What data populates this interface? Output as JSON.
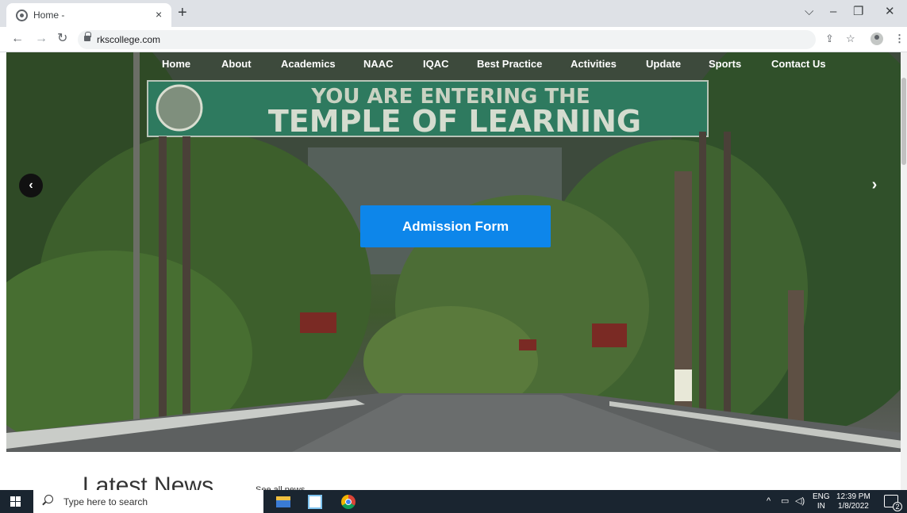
{
  "browser": {
    "tab_title": "Home -",
    "tab_close": "×",
    "new_tab": "+",
    "url": "rkscollege.com",
    "controls": {
      "menu": "⌵",
      "minimize": "–",
      "restore": "❐",
      "close": "✕"
    }
  },
  "site_nav": {
    "items": [
      {
        "label": "Home"
      },
      {
        "label": "About"
      },
      {
        "label": "Academics"
      },
      {
        "label": "NAAC"
      },
      {
        "label": "IQAC"
      },
      {
        "label": "Best Practice"
      },
      {
        "label": "Activities"
      },
      {
        "label": "Update"
      },
      {
        "label": "Sports"
      },
      {
        "label": "Contact Us"
      }
    ]
  },
  "hero": {
    "arch_line1": "YOU ARE ENTERING THE",
    "arch_line2": "TEMPLE OF LEARNING",
    "admission_label": "Admission Form",
    "prev_label": "‹",
    "next_label": "›"
  },
  "news": {
    "heading": "Latest News",
    "see_all": "See all news"
  },
  "taskbar": {
    "search_placeholder": "Type here to search",
    "lang_top": "ENG",
    "lang_bottom": "IN",
    "time": "12:39 PM",
    "date": "1/8/2022",
    "notification_count": "2"
  },
  "colors": {
    "accent": "#0d86ea",
    "arch_green": "#2e7a5f",
    "taskbar": "#1a2530"
  },
  "icons": [
    "favicon",
    "back-arrow",
    "forward-arrow",
    "reload",
    "lock",
    "share",
    "bookmark-star",
    "profile",
    "more-menu",
    "windows-start",
    "search",
    "file-explorer",
    "app-window",
    "chrome",
    "tray-chevron",
    "network",
    "volume",
    "notifications"
  ]
}
